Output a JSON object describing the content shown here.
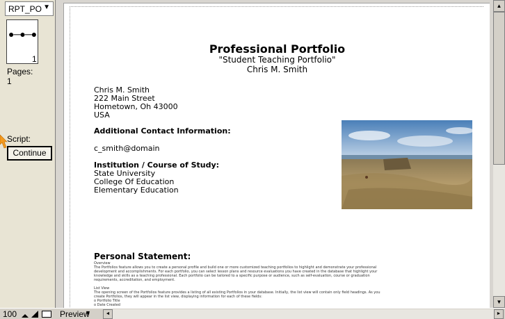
{
  "left_panel": {
    "layout_name": "RPT_PO",
    "page_number": "1",
    "pages_label": "Pages:",
    "pages_value": "1",
    "script_label": "Script:",
    "continue_label": "Continue"
  },
  "document": {
    "title": "Professional Portfolio",
    "subtitle": "\"Student Teaching Portfolio\"",
    "author": "Chris M. Smith",
    "address": {
      "name": "Chris M. Smith",
      "street": "222 Main Street",
      "city": "Hometown, Oh  43000",
      "country": "USA"
    },
    "contact_heading": "Additional Contact Information:",
    "email": "c_smith@domain",
    "institution_heading": "Institution / Course of Study:",
    "institution_lines": [
      "State University",
      "College Of Education",
      "Elementary Education"
    ],
    "statement_heading": "Personal Statement:",
    "statement_text": [
      "Overview",
      "The Portfolios feature allows you to create a personal profile and build one or more customized teaching portfolios to highlight and demonstrate your professional",
      "development and accomplishments. For each portfolio, you can select lesson plans and resource evaluations you have created in the database that highlight your",
      "knowledge and skills as a teaching professional. Each portfolio can be tailored to a specific purpose or audience, such as self-evaluation, course or graduation",
      "requirements, accreditation, and employment.",
      "",
      "List View",
      "The opening screen of the Portfolios feature provides a listing of all existing Portfolios in your database. Initially, the list view will contain only field headings. As you",
      "create Portfolios, they will appear in the list view, displaying information for each of these fields:",
      "o Portfolio Title",
      "o Date Created"
    ]
  },
  "statusbar": {
    "zoom": "100",
    "mode": "Preview"
  }
}
